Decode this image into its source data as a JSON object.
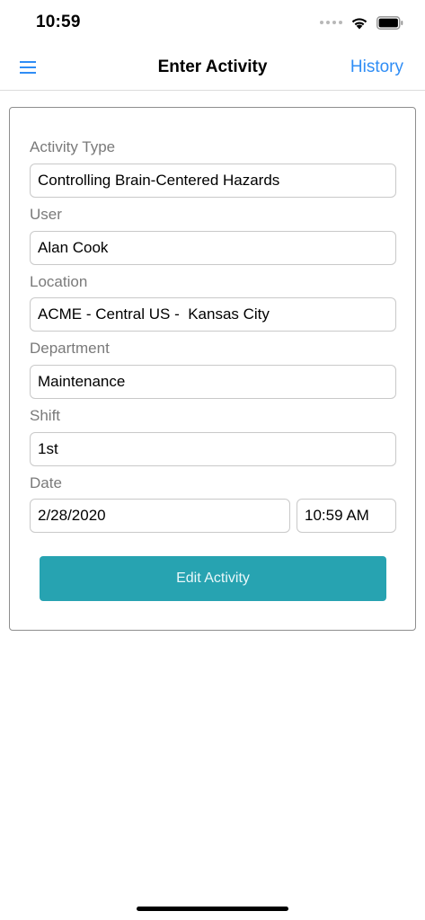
{
  "status_bar": {
    "time": "10:59",
    "icons": [
      "signal-icon",
      "wifi-icon",
      "battery-icon"
    ]
  },
  "nav": {
    "menu_icon": "hamburger-menu-icon",
    "title": "Enter Activity",
    "history_label": "History"
  },
  "form": {
    "activity_type": {
      "label": "Activity Type",
      "value": "Controlling Brain-Centered Hazards"
    },
    "user": {
      "label": "User",
      "value": "Alan Cook"
    },
    "location": {
      "label": "Location",
      "value": "ACME - Central US -  Kansas City"
    },
    "department": {
      "label": "Department",
      "value": "Maintenance"
    },
    "shift": {
      "label": "Shift",
      "value": "1st"
    },
    "date": {
      "label": "Date",
      "date_value": "2/28/2020",
      "time_value": "10:59 AM"
    },
    "submit_label": "Edit Activity"
  },
  "colors": {
    "accent_link": "#2f8df5",
    "button": "#27a3b1",
    "label": "#7a7a7a",
    "border": "#c9c9c9"
  }
}
